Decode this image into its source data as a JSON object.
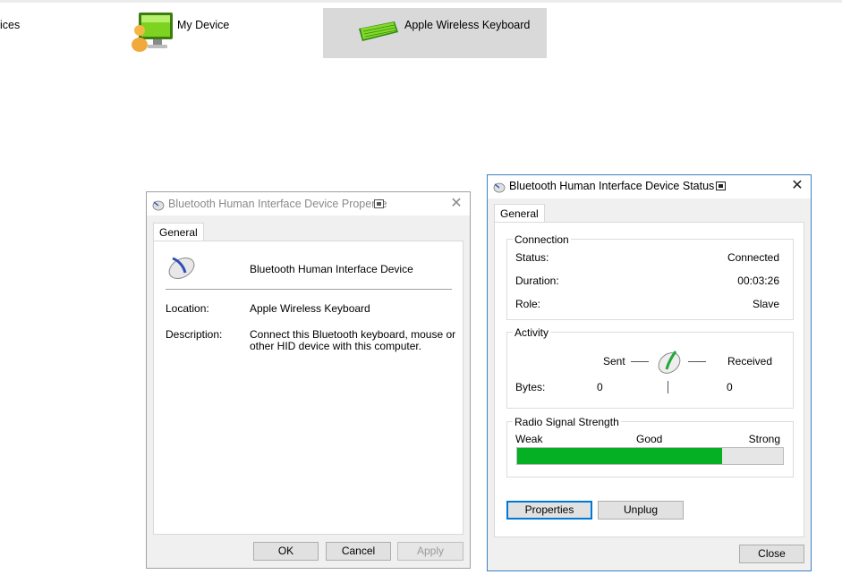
{
  "devices": [
    {
      "label": "ices",
      "icon": "devices-icon"
    },
    {
      "label": "My Device",
      "icon": "my-device-icon"
    },
    {
      "label": "Apple Wireless Keyboard",
      "icon": "keyboard-icon",
      "selected": true
    }
  ],
  "properties_dialog": {
    "title": "Bluetooth Human Interface Device Propertie",
    "tab": "General",
    "device_name": "Bluetooth Human Interface Device",
    "location_label": "Location:",
    "location_value": "Apple Wireless Keyboard",
    "description_label": "Description:",
    "description_line1": "Connect this Bluetooth keyboard, mouse or",
    "description_line2": "other HID device with this computer.",
    "ok": "OK",
    "cancel": "Cancel",
    "apply": "Apply"
  },
  "status_dialog": {
    "title": "Bluetooth Human Interface Device Status",
    "tab": "General",
    "connection": {
      "label": "Connection",
      "status_label": "Status:",
      "status_value": "Connected",
      "duration_label": "Duration:",
      "duration_value": "00:03:26",
      "role_label": "Role:",
      "role_value": "Slave"
    },
    "activity": {
      "label": "Activity",
      "sent_label": "Sent",
      "received_label": "Received",
      "bytes_label": "Bytes:",
      "bytes_sent": "0",
      "bytes_received": "0"
    },
    "signal": {
      "label": "Radio Signal Strength",
      "weak": "Weak",
      "good": "Good",
      "strong": "Strong",
      "level_fraction": 0.77,
      "bar_color": "#06b025"
    },
    "properties_button": "Properties",
    "unplug_button": "Unplug",
    "close_button": "Close"
  },
  "colors": {
    "accent": "#0078d7",
    "selection": "#d9d9d9"
  }
}
